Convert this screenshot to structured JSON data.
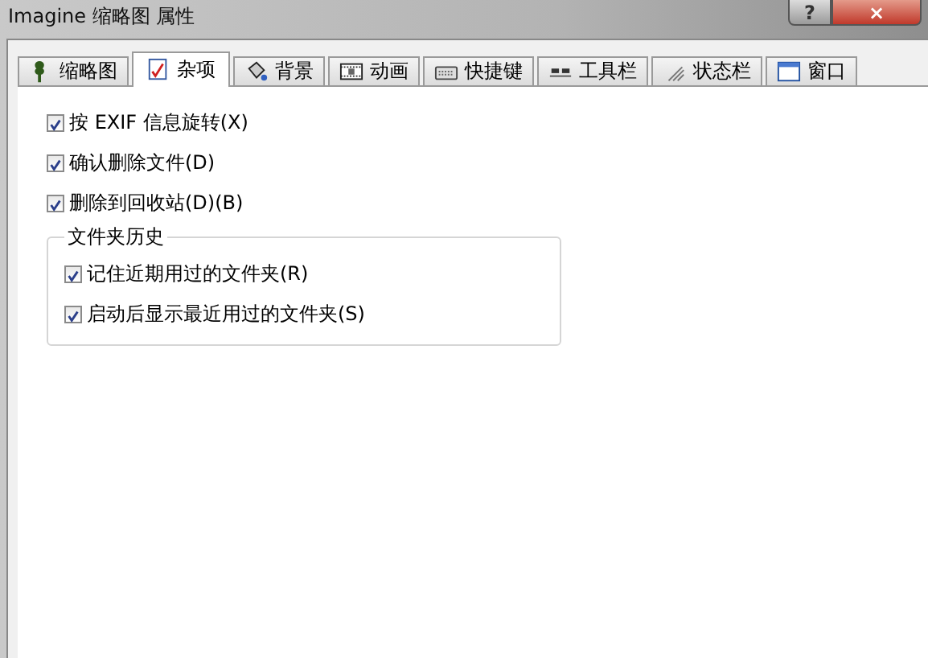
{
  "window": {
    "title": "Imagine 缩略图 属性",
    "buttons": [
      {
        "kind": "help",
        "label": "?"
      },
      {
        "kind": "close",
        "label": "×"
      }
    ]
  },
  "tabs": [
    {
      "label": "缩略图",
      "kind": "plant",
      "selected": false
    },
    {
      "label": "杂项",
      "kind": "note",
      "selected": true
    },
    {
      "label": "背景",
      "kind": "bucket",
      "selected": false
    },
    {
      "label": "动画",
      "kind": "film",
      "selected": false
    },
    {
      "label": "快捷键",
      "kind": "keyboard",
      "selected": false
    },
    {
      "label": "工具栏",
      "kind": "toolbar",
      "selected": false
    },
    {
      "label": "状态栏",
      "kind": "grip",
      "selected": false
    },
    {
      "label": "窗口",
      "kind": "window",
      "selected": false
    }
  ],
  "options": [
    {
      "label": "按 EXIF 信息旋转(X)",
      "checked": true
    },
    {
      "label": "确认删除文件(D)",
      "checked": true
    },
    {
      "label": "删除到回收站(D)(B)",
      "checked": true
    }
  ],
  "folder_history": {
    "title": "文件夹历史",
    "options": [
      {
        "label": "记住近期用过的文件夹(R)",
        "checked": true
      },
      {
        "label": "启动后显示最近用过的文件夹(S)",
        "checked": true
      }
    ]
  }
}
